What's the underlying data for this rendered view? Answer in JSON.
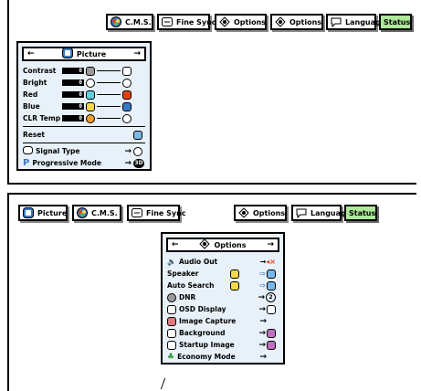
{
  "top_tabs": {
    "cms": "C.M.S.",
    "finesync": "Fine Sync",
    "options1": "Options",
    "options2": "Options",
    "language": "Language",
    "status": "Status"
  },
  "picture_menu": {
    "title": "Picture",
    "rows": [
      {
        "label": "Contrast",
        "value": "0"
      },
      {
        "label": "Bright",
        "value": "0"
      },
      {
        "label": "Red",
        "value": "0"
      },
      {
        "label": "Blue",
        "value": "0"
      },
      {
        "label": "CLR Temp",
        "value": "0"
      }
    ],
    "reset": "Reset",
    "signal_type": "Signal Type",
    "progressive_mode": "Progressive Mode",
    "progressive_value": "3D"
  },
  "bottom_tabs": {
    "picture": "Picture",
    "cms": "C.M.S.",
    "finesync": "Fine Sync",
    "options": "Options",
    "language": "Language",
    "status": "Status"
  },
  "options_menu": {
    "title": "Options",
    "rows": [
      {
        "label": "Audio Out"
      },
      {
        "label": "Speaker"
      },
      {
        "label": "Auto Search"
      },
      {
        "label": "DNR",
        "value": "2"
      },
      {
        "label": "OSD Display"
      },
      {
        "label": "Image Capture"
      },
      {
        "label": "Background"
      },
      {
        "label": "Startup Image"
      },
      {
        "label": "Economy Mode"
      }
    ]
  },
  "colors": {
    "status_bg": "#aee89a",
    "menu_bg": "#e8f1f9",
    "accent_blue": "#3a78c8",
    "red": "#e0431a"
  }
}
